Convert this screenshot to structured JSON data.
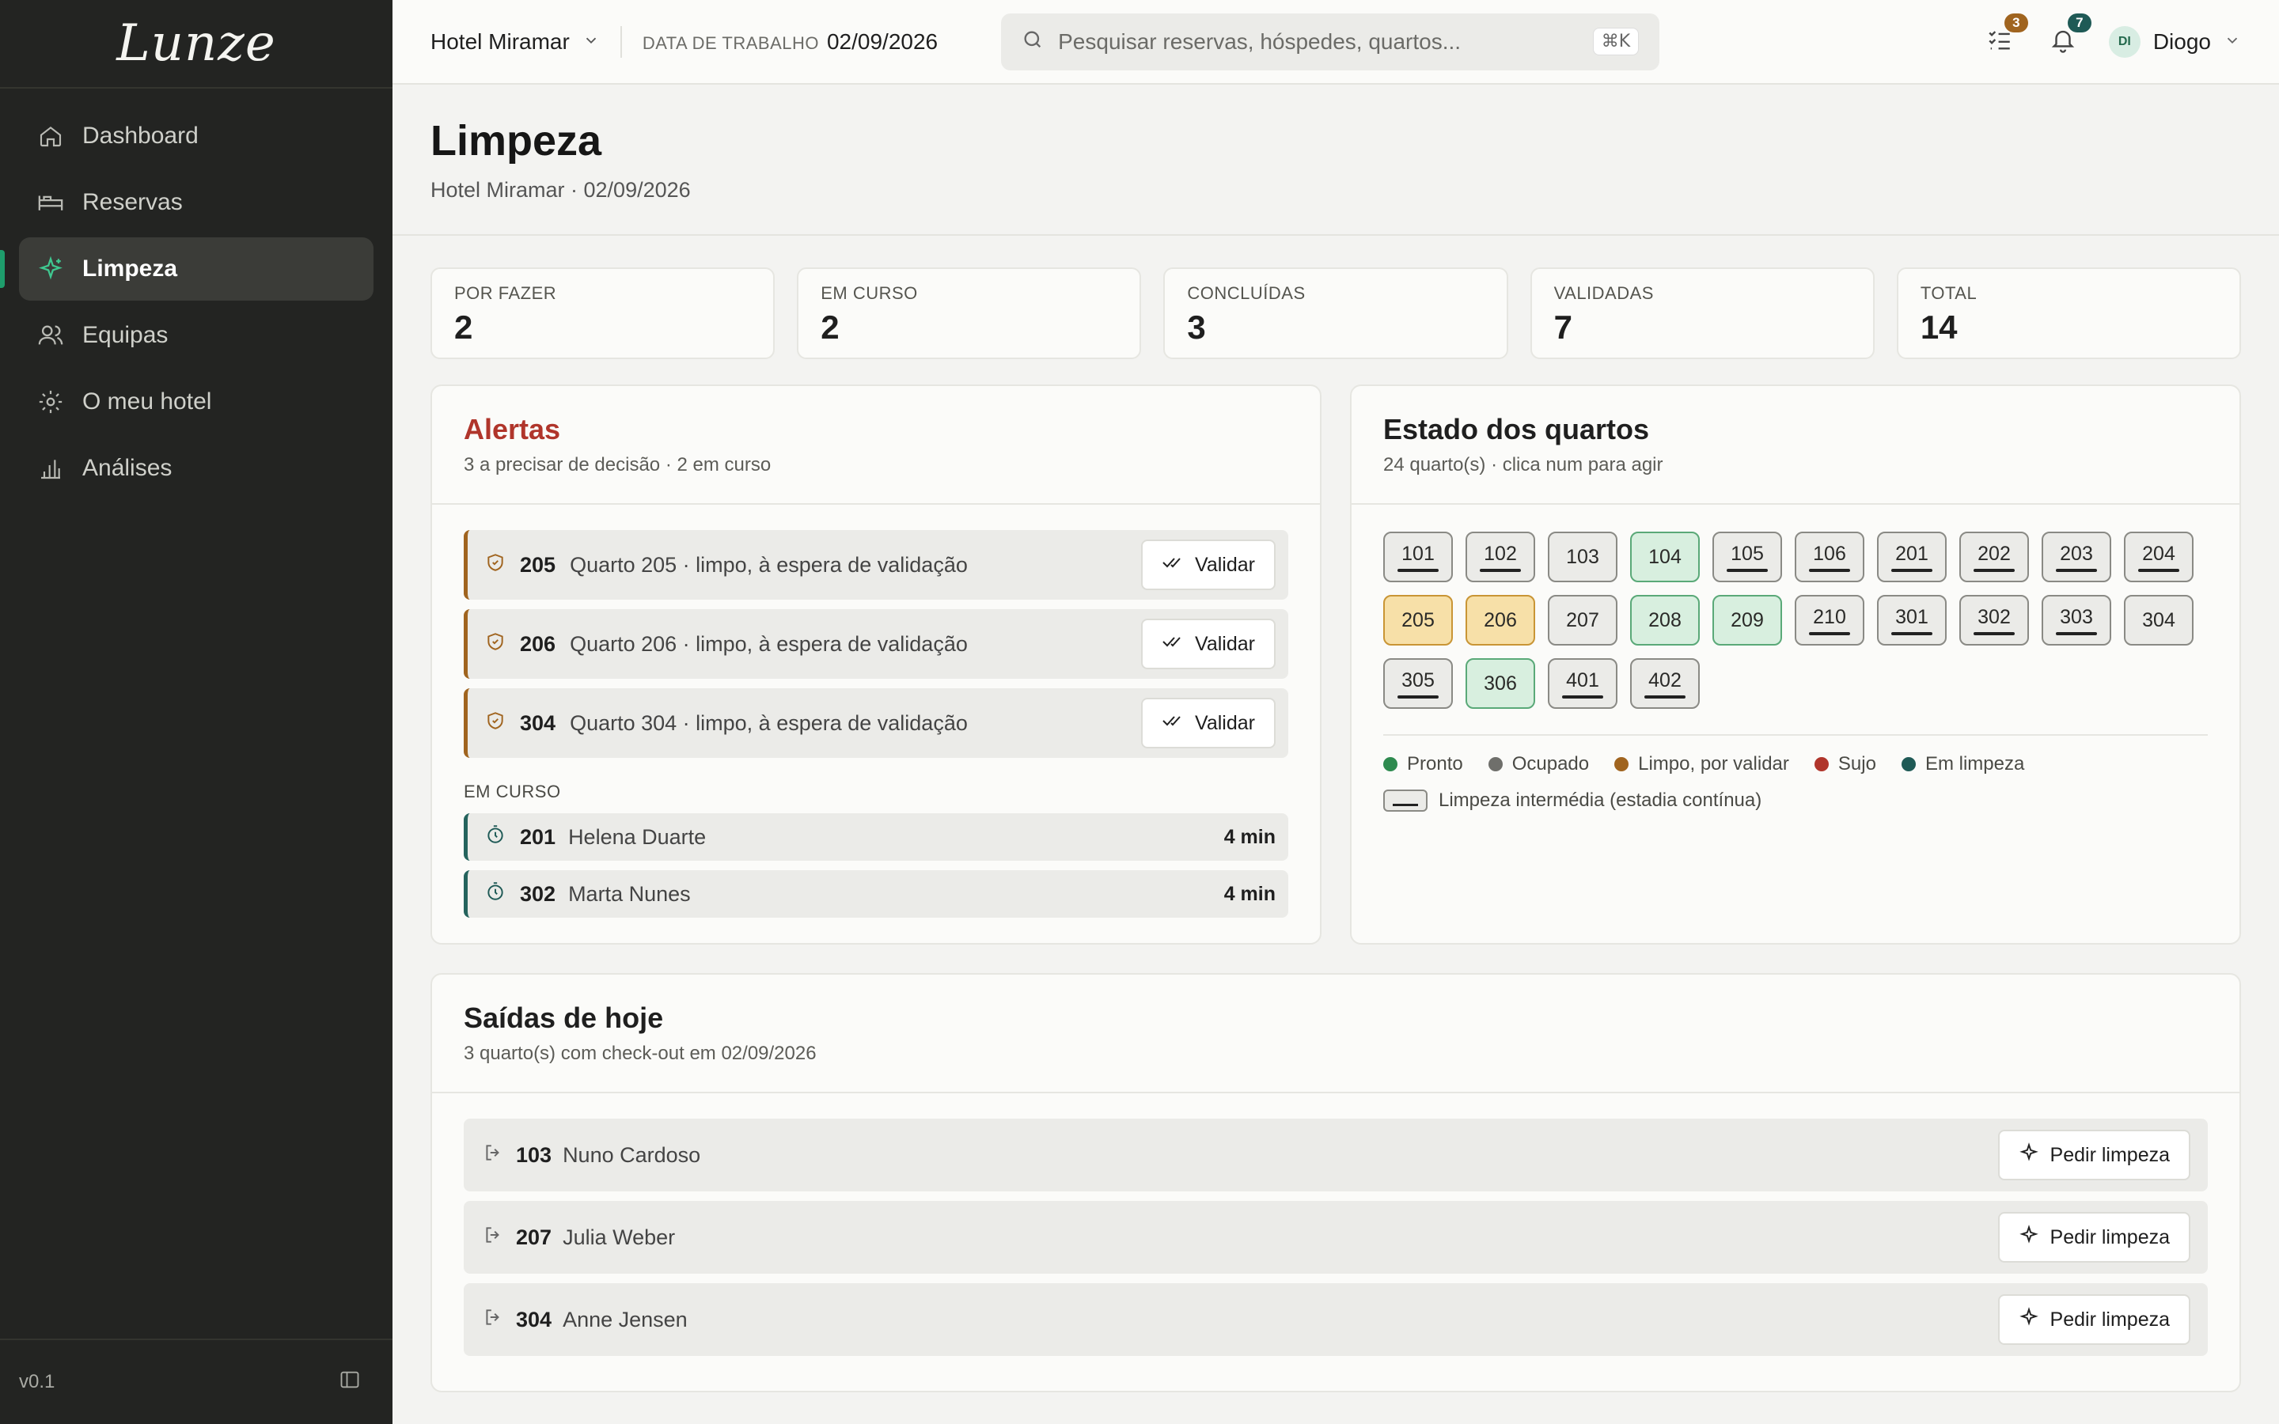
{
  "sidebar": {
    "logo": "Lunze",
    "items": [
      {
        "label": "Dashboard",
        "icon": "home-icon",
        "active": false
      },
      {
        "label": "Reservas",
        "icon": "bed-icon",
        "active": false
      },
      {
        "label": "Limpeza",
        "icon": "sparkles-icon",
        "active": true
      },
      {
        "label": "Equipas",
        "icon": "users-icon",
        "active": false
      },
      {
        "label": "O meu hotel",
        "icon": "gear-icon",
        "active": false
      },
      {
        "label": "Análises",
        "icon": "bar-chart-icon",
        "active": false
      }
    ],
    "version": "v0.1"
  },
  "topbar": {
    "hotel": "Hotel Miramar",
    "workdate_label": "DATA DE TRABALHO",
    "workdate_value": "02/09/2026",
    "search_placeholder": "Pesquisar reservas, hóspedes, quartos...",
    "search_shortcut": "⌘K",
    "tasks_badge": "3",
    "notifications_badge": "7",
    "user_initials": "DI",
    "user_name": "Diogo"
  },
  "page": {
    "title": "Limpeza",
    "subtitle": "Hotel Miramar · 02/09/2026"
  },
  "stats": [
    {
      "label": "POR FAZER",
      "value": "2"
    },
    {
      "label": "EM CURSO",
      "value": "2"
    },
    {
      "label": "CONCLUÍDAS",
      "value": "3"
    },
    {
      "label": "VALIDADAS",
      "value": "7"
    },
    {
      "label": "TOTAL",
      "value": "14"
    }
  ],
  "alerts": {
    "title": "Alertas",
    "subtitle": "3 a precisar de decisão · 2 em curso",
    "items": [
      {
        "room": "205",
        "text": "Quarto 205 · limpo, à espera de validação",
        "action": "Validar"
      },
      {
        "room": "206",
        "text": "Quarto 206 · limpo, à espera de validação",
        "action": "Validar"
      },
      {
        "room": "304",
        "text": "Quarto 304 · limpo, à espera de validação",
        "action": "Validar"
      }
    ],
    "in_progress_label": "EM CURSO",
    "in_progress": [
      {
        "room": "201",
        "name": "Helena Duarte",
        "time": "4 min"
      },
      {
        "room": "302",
        "name": "Marta Nunes",
        "time": "4 min"
      }
    ]
  },
  "rooms": {
    "title": "Estado dos quartos",
    "subtitle": "24 quarto(s) · clica num para agir",
    "items": [
      {
        "n": "101",
        "state": "occupied",
        "mid": true
      },
      {
        "n": "102",
        "state": "occupied",
        "mid": true
      },
      {
        "n": "103",
        "state": "occupied",
        "mid": false
      },
      {
        "n": "104",
        "state": "ready",
        "mid": false
      },
      {
        "n": "105",
        "state": "occupied",
        "mid": true
      },
      {
        "n": "106",
        "state": "occupied",
        "mid": true
      },
      {
        "n": "201",
        "state": "occupied",
        "mid": true
      },
      {
        "n": "202",
        "state": "occupied",
        "mid": true
      },
      {
        "n": "203",
        "state": "occupied",
        "mid": true
      },
      {
        "n": "204",
        "state": "occupied",
        "mid": true
      },
      {
        "n": "205",
        "state": "validate",
        "mid": false
      },
      {
        "n": "206",
        "state": "validate",
        "mid": false
      },
      {
        "n": "207",
        "state": "occupied",
        "mid": false
      },
      {
        "n": "208",
        "state": "ready",
        "mid": false
      },
      {
        "n": "209",
        "state": "ready",
        "mid": false
      },
      {
        "n": "210",
        "state": "occupied",
        "mid": true
      },
      {
        "n": "301",
        "state": "occupied",
        "mid": true
      },
      {
        "n": "302",
        "state": "occupied",
        "mid": true
      },
      {
        "n": "303",
        "state": "occupied",
        "mid": true
      },
      {
        "n": "304",
        "state": "occupied",
        "mid": false
      },
      {
        "n": "305",
        "state": "occupied",
        "mid": true
      },
      {
        "n": "306",
        "state": "ready",
        "mid": false
      },
      {
        "n": "401",
        "state": "occupied",
        "mid": true
      },
      {
        "n": "402",
        "state": "occupied",
        "mid": true
      }
    ],
    "legend": [
      {
        "label": "Pronto",
        "color": "#2e8a4f"
      },
      {
        "label": "Ocupado",
        "color": "#6f6f6b"
      },
      {
        "label": "Limpo, por validar",
        "color": "#a0641f"
      },
      {
        "label": "Sujo",
        "color": "#b0352b"
      },
      {
        "label": "Em limpeza",
        "color": "#1f5a56"
      }
    ],
    "legend_mid": "Limpeza intermédia (estadia contínua)"
  },
  "departures": {
    "title": "Saídas de hoje",
    "subtitle": "3 quarto(s) com check-out em 02/09/2026",
    "items": [
      {
        "room": "103",
        "name": "Nuno Cardoso",
        "action": "Pedir limpeza"
      },
      {
        "room": "207",
        "name": "Julia Weber",
        "action": "Pedir limpeza"
      },
      {
        "room": "304",
        "name": "Anne Jensen",
        "action": "Pedir limpeza"
      }
    ]
  },
  "colors": {
    "sidebar_bg": "#232422",
    "accent": "#1e9d6c",
    "alert_title": "#b0352b",
    "tasks_badge": "#a0641f",
    "notifications_badge": "#1f5a56"
  }
}
